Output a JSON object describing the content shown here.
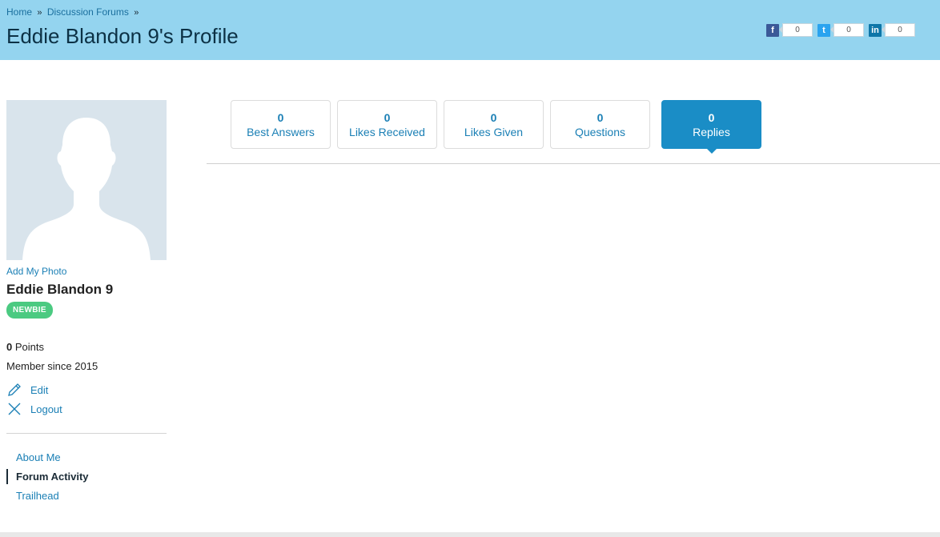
{
  "breadcrumb": {
    "home": "Home",
    "forums": "Discussion Forums",
    "sep": "»"
  },
  "page_title": "Eddie Blandon 9's Profile",
  "share": {
    "facebook": {
      "icon": "f",
      "count": "0"
    },
    "twitter": {
      "icon": "t",
      "count": "0"
    },
    "linkedin": {
      "icon": "in",
      "count": "0"
    }
  },
  "profile": {
    "add_photo": "Add My Photo",
    "name": "Eddie Blandon 9",
    "badge": "NEWBIE",
    "points_value": "0",
    "points_label": "Points",
    "member_since": "Member since 2015",
    "edit_label": "Edit",
    "logout_label": "Logout"
  },
  "nav": [
    {
      "label": "About Me",
      "active": false
    },
    {
      "label": "Forum Activity",
      "active": true
    },
    {
      "label": "Trailhead",
      "active": false
    }
  ],
  "tabs": [
    {
      "count": "0",
      "label": "Best Answers",
      "active": false
    },
    {
      "count": "0",
      "label": "Likes Received",
      "active": false
    },
    {
      "count": "0",
      "label": "Likes Given",
      "active": false
    },
    {
      "count": "0",
      "label": "Questions",
      "active": false
    },
    {
      "count": "0",
      "label": "Replies",
      "active": true
    }
  ],
  "colors": {
    "header_bg": "#94d4ef",
    "link": "#1a7fb5",
    "active_tab": "#1a8dc6",
    "badge": "#4bca81"
  }
}
